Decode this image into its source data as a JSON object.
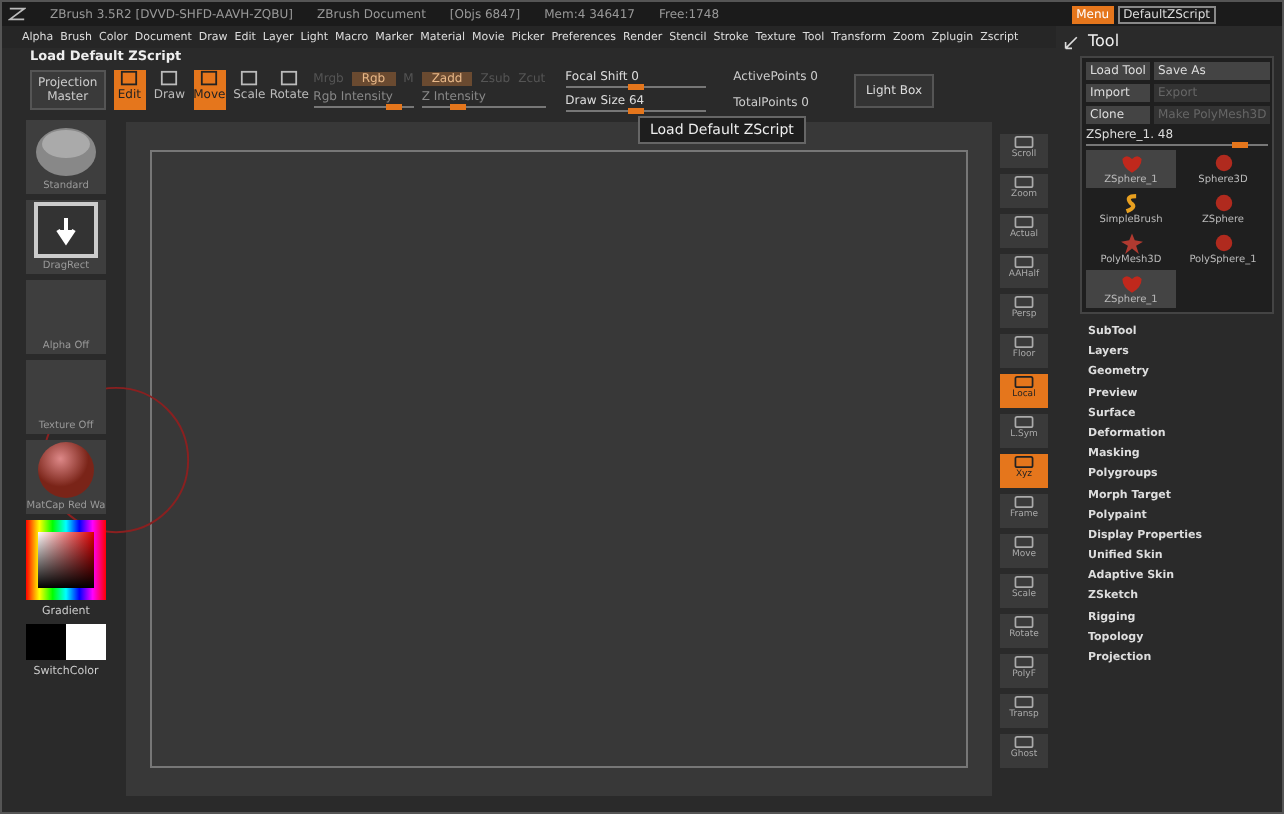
{
  "title_bar": {
    "texts": [
      "ZBrush 3.5R2 [DVVD-SHFD-AAVH-ZQBU]",
      "ZBrush Document",
      "[Objs 6847]",
      "Mem:4 346417",
      "Free:1748"
    ],
    "menu_button": "Menu",
    "script_button": "DefaultZScript"
  },
  "menu_bar": [
    "Alpha",
    "Brush",
    "Color",
    "Document",
    "Draw",
    "Edit",
    "Layer",
    "Light",
    "Macro",
    "Marker",
    "Material",
    "Movie",
    "Picker",
    "Preferences",
    "Render",
    "Stencil",
    "Stroke",
    "Texture",
    "Tool",
    "Transform",
    "Zoom",
    "Zplugin",
    "Zscript"
  ],
  "script_label": "Load Default ZScript",
  "toolbar": {
    "projection_master": [
      "Projection",
      "Master"
    ],
    "modes": [
      {
        "label": "Edit",
        "selected": true
      },
      {
        "label": "Draw",
        "selected": false
      },
      {
        "label": "Move",
        "selected": true
      },
      {
        "label": "Scale",
        "selected": false
      },
      {
        "label": "Rotate",
        "selected": false
      }
    ],
    "dim_controls": [
      "Mrgb",
      "Rgb",
      "M",
      "Zadd",
      "Zsub",
      "Zcut"
    ],
    "intensities": [
      {
        "label": "Rgb Intensity",
        "level": 0.8
      },
      {
        "label": "Z Intensity",
        "level": 0.3
      }
    ],
    "sliders": [
      {
        "label": "Focal Shift 0",
        "level": 0.5
      },
      {
        "label": "Draw Size 64",
        "level": 0.5
      }
    ],
    "counts": [
      "ActivePoints 0",
      "TotalPoints 0"
    ],
    "light_box": "Light Box"
  },
  "tooltip": "Load Default ZScript",
  "left_shelf": [
    {
      "kind": "brush",
      "label": "Standard"
    },
    {
      "kind": "stroke",
      "label": "DragRect"
    },
    {
      "kind": "empty",
      "label": "Alpha Off"
    },
    {
      "kind": "empty",
      "label": "Texture Off"
    },
    {
      "kind": "material",
      "label": "MatCap Red Wa"
    }
  ],
  "color_picker": {
    "label": "Gradient"
  },
  "switch_color": {
    "label": "SwitchColor"
  },
  "right_shelf": [
    {
      "label": "Scroll",
      "selected": false
    },
    {
      "label": "Zoom",
      "selected": false
    },
    {
      "label": "Actual",
      "selected": false
    },
    {
      "label": "AAHalf",
      "selected": false
    },
    {
      "label": "Persp",
      "selected": false
    },
    {
      "label": "Floor",
      "selected": false
    },
    {
      "label": "Local",
      "selected": true
    },
    {
      "label": "L.Sym",
      "selected": false
    },
    {
      "label": "Xyz",
      "selected": true
    },
    {
      "label": "Frame",
      "selected": false
    },
    {
      "label": "Move",
      "selected": false
    },
    {
      "label": "Scale",
      "selected": false
    },
    {
      "label": "Rotate",
      "selected": false
    },
    {
      "label": "PolyF",
      "selected": false
    },
    {
      "label": "Transp",
      "selected": false
    },
    {
      "label": "Ghost",
      "selected": false
    }
  ],
  "tool_panel": {
    "title": "Tool",
    "buttons": [
      {
        "label": "Load Tool",
        "disabled": false
      },
      {
        "label": "Save As",
        "disabled": false
      },
      {
        "label": "Import",
        "disabled": false
      },
      {
        "label": "Export",
        "disabled": true
      },
      {
        "label": "Clone",
        "disabled": false
      },
      {
        "label": "Make PolyMesh3D",
        "disabled": true
      }
    ],
    "slider": {
      "label": "ZSphere_1. 48",
      "level": 0.85
    },
    "tools": [
      {
        "label": "ZSphere_1",
        "kind": "zsphere",
        "selected": true
      },
      {
        "label": "Sphere3D",
        "kind": "sphere",
        "selected": false
      },
      {
        "label": "SimpleBrush",
        "kind": "brush",
        "selected": false
      },
      {
        "label": "ZSphere",
        "kind": "sphere",
        "selected": false
      },
      {
        "label": "PolyMesh3D",
        "kind": "star",
        "selected": false
      },
      {
        "label": "PolySphere_1",
        "kind": "sphere",
        "selected": false
      },
      {
        "label": "ZSphere_1",
        "kind": "zsphere",
        "selected": true
      }
    ],
    "sections": [
      "SubTool",
      "Layers",
      "Geometry",
      "Preview",
      "Surface",
      "Deformation",
      "Masking",
      "Polygroups",
      "Morph Target",
      "Polypaint",
      "Display Properties",
      "Unified Skin",
      "Adaptive Skin",
      "ZSketch",
      "Rigging",
      "Topology",
      "Projection"
    ]
  }
}
